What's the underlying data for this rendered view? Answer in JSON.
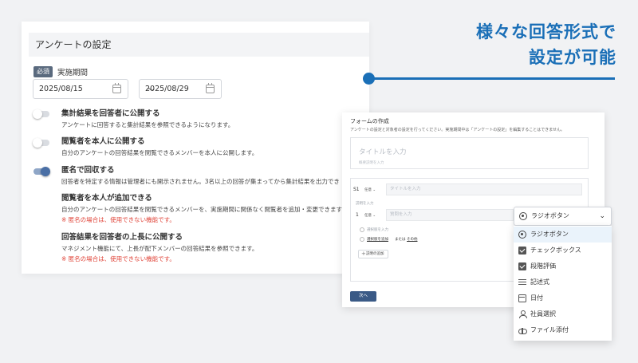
{
  "settings": {
    "title": "アンケートの設定",
    "required_badge": "必須",
    "period_label": "実施期間",
    "start_date": "2025/08/15",
    "end_date": "2025/08/29",
    "range_separator": "〜",
    "options": [
      {
        "title": "集計結果を回答者に公開する",
        "description": "アンケートに回答すると集計結果を参照できるようになります。",
        "enabled": false
      },
      {
        "title": "閲覧者を本人に公開する",
        "description": "自分のアンケートの回答結果を閲覧できるメンバーを本人に公開します。",
        "enabled": false
      },
      {
        "title": "匿名で回収する",
        "description": "回答者を特定する情報は管理者にも開示されません。3名以上の回答が集まってから集計結果を出力でき",
        "enabled": true
      },
      {
        "title": "閲覧者を本人が追加できる",
        "description": "自分のアンケートの回答結果を閲覧できるメンバーを、実施期間に関係なく閲覧者を追加・変更できます",
        "warning": "※ 匿名の場合は、使用できない機能です。"
      },
      {
        "title": "回答結果を回答者の上長に公開する",
        "description": "マネジメント機能にて、上長が配下メンバーの回答結果を参照できます。",
        "warning": "※ 匿名の場合は、使用できない機能です。"
      }
    ]
  },
  "headline": {
    "line1": "様々な回答形式で",
    "line2": "設定が可能"
  },
  "form": {
    "title": "フォームの作成",
    "description": "アンケートの設定と対象者の設定を行ってください。実施期間中は「アンケートの設定」を編集することはできません。",
    "title_placeholder": "タイトルを入力",
    "title_desc_placeholder": "概要説明を入力",
    "section_number": "S1",
    "section_type": "任意 ⌄",
    "section_title_placeholder": "タイトルを入力",
    "section_desc_placeholder": "説明を入力",
    "question_number": "1",
    "question_type": "任意 ⌄",
    "question_placeholder": "質問を入力",
    "choice_placeholder": "選択肢を入力",
    "add_choice": "選択肢を追加",
    "or_text": "または",
    "other_text": "その他",
    "add_description": "説明の追加",
    "next_button": "次へ"
  },
  "dropdown": {
    "selected": "ラジオボタン",
    "items": [
      {
        "label": "ラジオボタン",
        "icon": "radio-icon",
        "active": true
      },
      {
        "label": "チェックボックス",
        "icon": "checkbox-icon",
        "active": false
      },
      {
        "label": "段階評価",
        "icon": "rating-checkbox-icon",
        "active": false
      },
      {
        "label": "記述式",
        "icon": "text-lines-icon",
        "active": false
      },
      {
        "label": "日付",
        "icon": "calendar-icon",
        "active": false
      },
      {
        "label": "社員選択",
        "icon": "user-icon",
        "active": false
      },
      {
        "label": "ファイル添付",
        "icon": "cloud-upload-icon",
        "active": false
      }
    ]
  },
  "colors": {
    "accent": "#1a6fb7",
    "warning": "#e0453a",
    "button": "#3a5a86"
  }
}
